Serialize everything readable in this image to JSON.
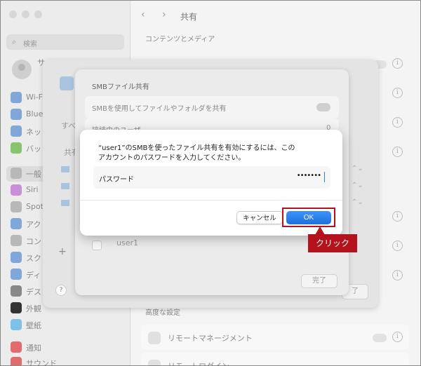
{
  "window": {
    "title": "共有"
  },
  "sidebar": {
    "search_placeholder": "検索",
    "account_name": "サ",
    "items": [
      {
        "label": "Wi-F",
        "color": "#7fa7d9"
      },
      {
        "label": "Bluet",
        "color": "#7fa7d9"
      },
      {
        "label": "ネット",
        "color": "#7fa7d9"
      },
      {
        "label": "バッ",
        "color": "#86c46e"
      },
      {
        "label": "一般",
        "color": "#b8b8b8"
      },
      {
        "label": "Siri",
        "color": "#c98fd8"
      },
      {
        "label": "Spot",
        "color": "#b8b8b8"
      },
      {
        "label": "アク",
        "color": "#7fa7d9"
      },
      {
        "label": "コン",
        "color": "#b8b8b8"
      },
      {
        "label": "スク",
        "color": "#7fa7d9"
      },
      {
        "label": "ディ",
        "color": "#7fa7d9"
      },
      {
        "label": "デス",
        "color": "#888888"
      },
      {
        "label": "外観",
        "color": "#333333"
      },
      {
        "label": "壁紙",
        "color": "#7fc0e6"
      },
      {
        "label": "通知",
        "color": "#e36b6b"
      },
      {
        "label": "サウンド",
        "color": "#e36b6b"
      }
    ]
  },
  "main": {
    "section_content": "コンテンツとメディア",
    "section_advanced": "高度な設定",
    "row_remote_management": "リモートマネージメント",
    "row_remote_login": "リモートログイン"
  },
  "sheet_back": {
    "label_all": "すべ",
    "label_shared": "共有"
  },
  "smb_sheet": {
    "title": "SMBファイル共有",
    "row_smb": "SMBを使用してファイルやフォルダを共有",
    "row_connected": "接続中のユーザ",
    "connected_count": "0",
    "user_name": "user1",
    "done_label": "完了",
    "back_button_label": "了"
  },
  "dialog": {
    "message_line1": "“user1”のSMBを使ったファイル共有を有効にするには、この",
    "message_line2": "アカウントのパスワードを入力してください。",
    "password_label": "パスワード",
    "password_value": "•••••••",
    "cancel_label": "キャンセル",
    "ok_label": "OK"
  },
  "annotation": {
    "callout_text": "クリック",
    "highlight_color": "#b4121c"
  },
  "icons": {
    "back": "‹",
    "forward": "›",
    "help": "?",
    "info": "i",
    "add": "+",
    "search": "⌕",
    "stepper": "⌃⌄"
  }
}
